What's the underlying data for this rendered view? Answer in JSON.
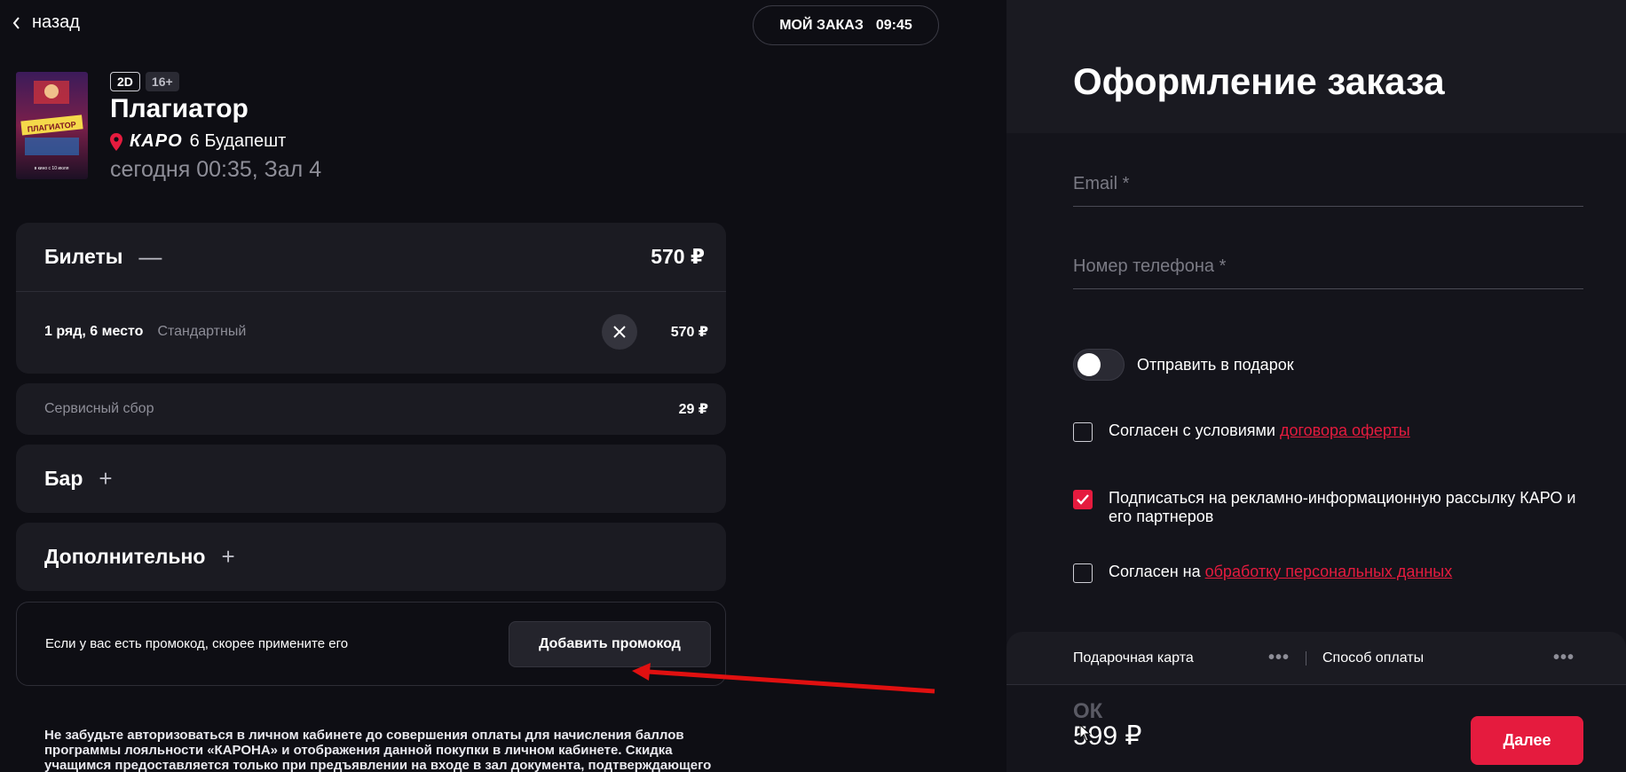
{
  "back": {
    "label": "назад"
  },
  "timer": {
    "label": "МОЙ ЗАКАЗ",
    "time": "09:45"
  },
  "movie": {
    "format": "2D",
    "age": "16+",
    "title": "Плагиатор",
    "cinema_brand": "КАРО",
    "cinema_name": "6 Будапешт",
    "session": "сегодня 00:35, Зал 4",
    "poster_text": "ПЛАГИАТОР",
    "poster_caption": "в кино с 10 июля"
  },
  "tickets": {
    "title": "Билеты",
    "toggle": "—",
    "total": "570 ₽",
    "rows": [
      {
        "place": "1 ряд, 6 место",
        "type": "Стандартный",
        "price": "570 ₽"
      }
    ]
  },
  "fee": {
    "label": "Сервисный сбор",
    "price": "29 ₽"
  },
  "bar": {
    "title": "Бар",
    "toggle": "+"
  },
  "extra": {
    "title": "Дополнительно",
    "toggle": "+"
  },
  "promo": {
    "text": "Если у вас есть промокод, скорее примените его",
    "button": "Добавить промокод"
  },
  "notice": "Не забудьте авторизоваться в личном кабинете до совершения оплаты для начисления баллов программы лояльности «КАРОНА» и отображения данной покупки в личном кабинете. Скидка учащимся предоставляется только при предъявлении на входе в зал документа, подтверждающего",
  "checkout": {
    "title": "Оформление заказа",
    "email_placeholder": "Email *",
    "phone_placeholder": "Номер телефона *",
    "gift_label": "Отправить в подарок",
    "agree_offer_prefix": "Согласен с условиями ",
    "agree_offer_link": "договора оферты",
    "subscribe_label": "Подписаться на рекламно-информационную рассылку КАРО и его партнеров",
    "agree_data_prefix": "Согласен на ",
    "agree_data_link": "обработку персональных данных",
    "gift_card": "Подарочная карта",
    "payment_method": "Способ оплаты",
    "dots": "•••",
    "ok_mark": "ОК",
    "total": "599 ₽",
    "next": "Далее"
  },
  "colors": {
    "accent": "#e51b3e",
    "bg": "#0e0e14",
    "card": "#1b1b22"
  }
}
